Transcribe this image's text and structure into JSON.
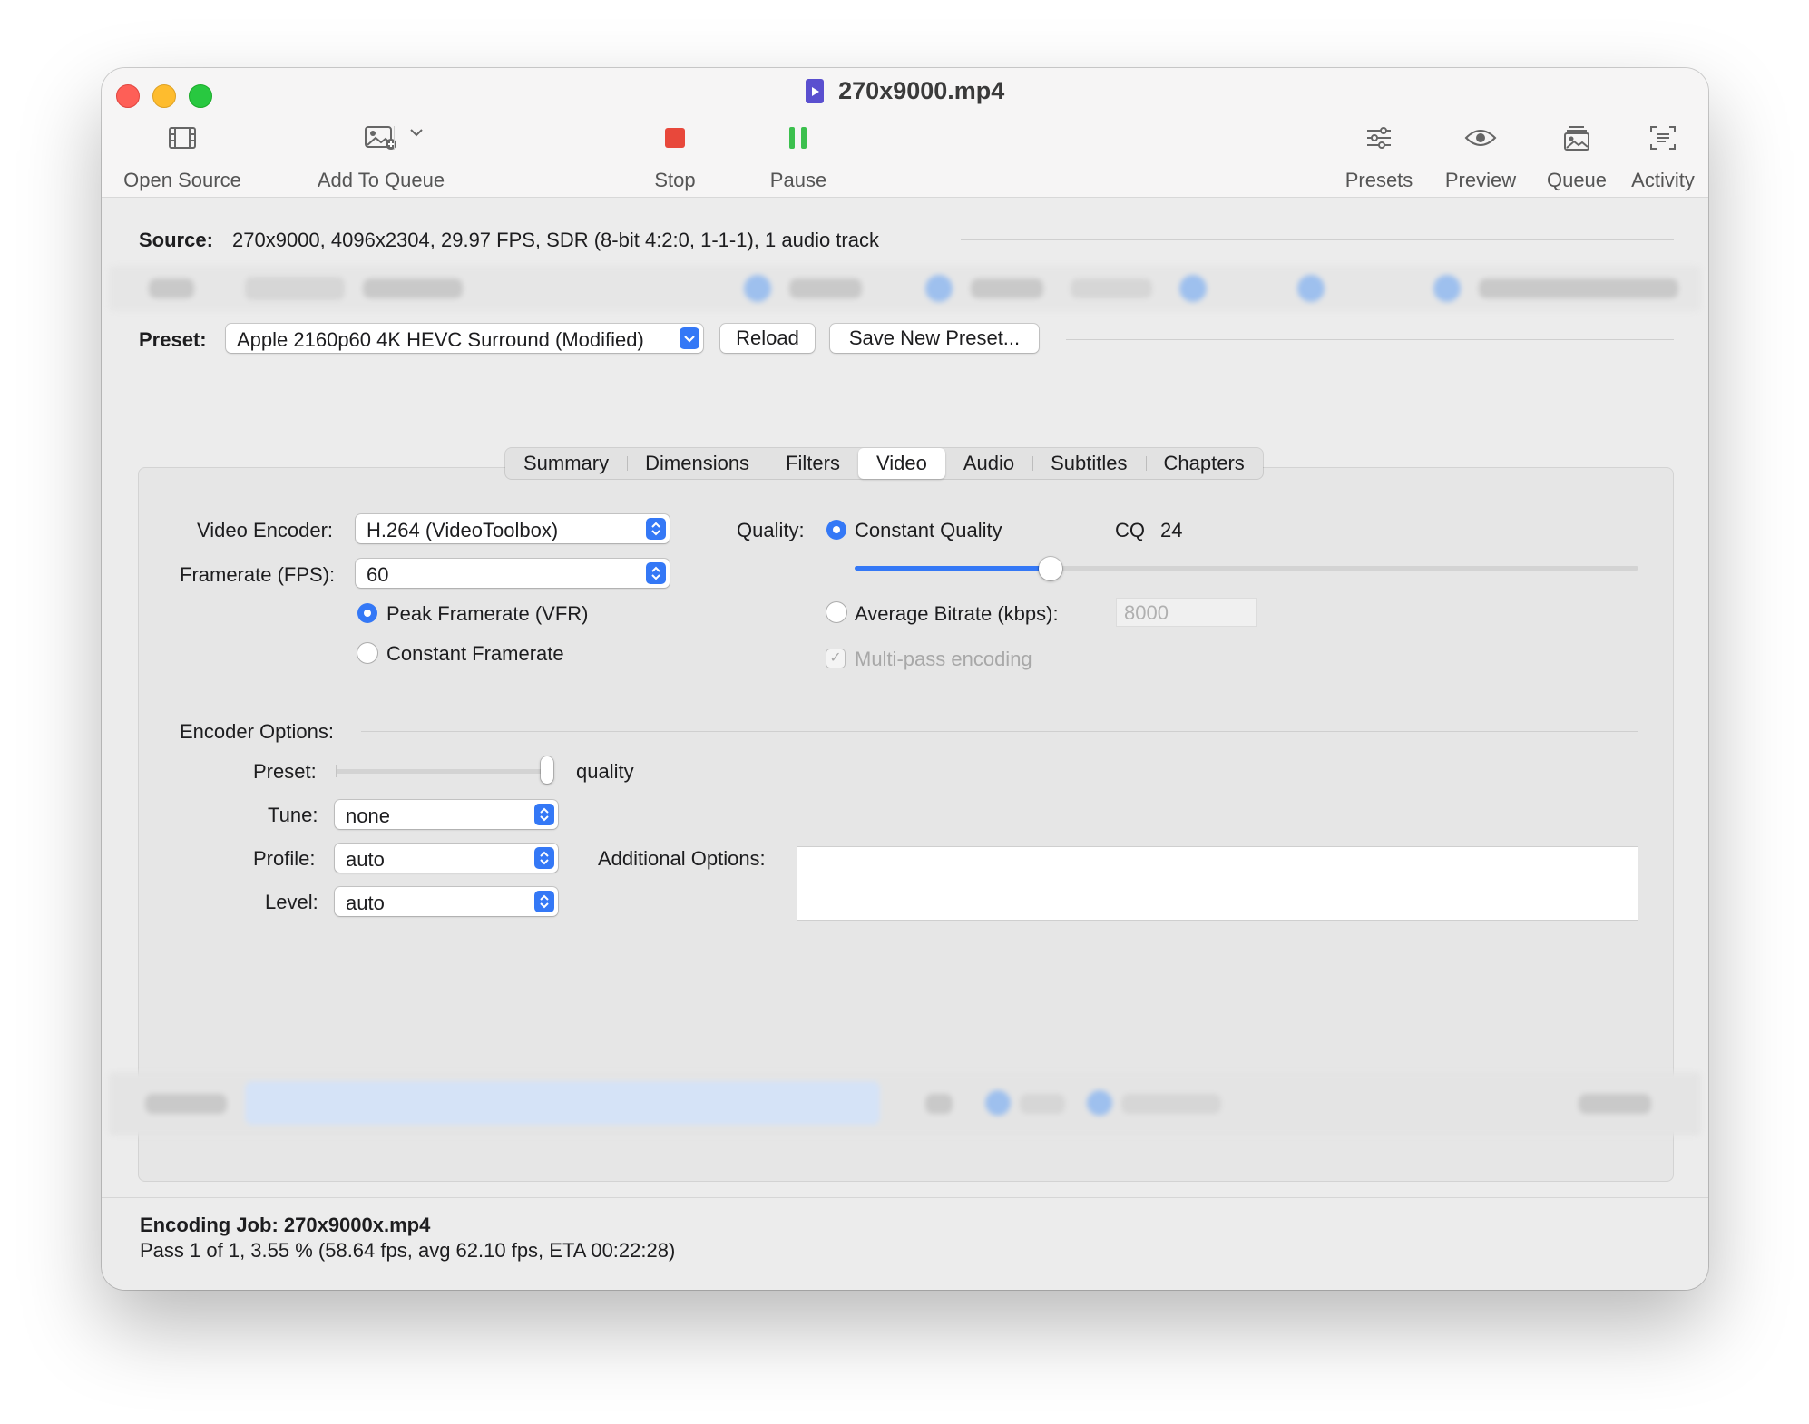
{
  "window": {
    "title": "270x9000.mp4"
  },
  "toolbar": {
    "open_source": "Open Source",
    "add_to_queue": "Add To Queue",
    "stop": "Stop",
    "pause": "Pause",
    "presets": "Presets",
    "preview": "Preview",
    "queue": "Queue",
    "activity": "Activity"
  },
  "source": {
    "label": "Source:",
    "info": "270x9000, 4096x2304, 29.97 FPS, SDR (8-bit 4:2:0, 1-1-1), 1 audio track"
  },
  "preset": {
    "label": "Preset:",
    "value": "Apple 2160p60 4K HEVC Surround (Modified)",
    "reload": "Reload",
    "save_new": "Save New Preset..."
  },
  "tabs": [
    "Summary",
    "Dimensions",
    "Filters",
    "Video",
    "Audio",
    "Subtitles",
    "Chapters"
  ],
  "selected_tab": "Video",
  "video": {
    "encoder_label": "Video Encoder:",
    "encoder_value": "H.264 (VideoToolbox)",
    "framerate_label": "Framerate (FPS):",
    "framerate_value": "60",
    "peak_framerate": "Peak Framerate (VFR)",
    "constant_framerate": "Constant Framerate",
    "quality_label": "Quality:",
    "constant_quality": "Constant Quality",
    "cq_label": "CQ",
    "cq_value": "24",
    "quality_slider_fraction": 0.25,
    "average_bitrate": "Average Bitrate (kbps):",
    "bitrate_value": "8000",
    "multipass": "Multi-pass encoding"
  },
  "encoder_options": {
    "title": "Encoder Options:",
    "preset_label": "Preset:",
    "preset_value_label": "quality",
    "preset_slider_fraction": 1.0,
    "tune_label": "Tune:",
    "tune_value": "none",
    "profile_label": "Profile:",
    "profile_value": "auto",
    "level_label": "Level:",
    "level_value": "auto",
    "additional_label": "Additional Options:"
  },
  "status": {
    "job": "Encoding Job: 270x9000x.mp4",
    "progress": "Pass 1 of 1, 3.55 % (58.64 fps, avg 62.10 fps, ETA 00:22:28)"
  },
  "colors": {
    "accent": "#3478f6",
    "stop": "#e8483b",
    "pause": "#3cc04e"
  }
}
